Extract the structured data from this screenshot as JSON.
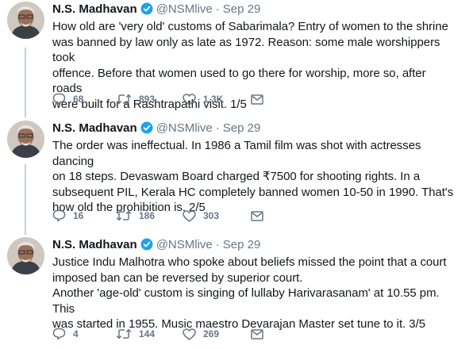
{
  "tweets": [
    {
      "name": "N.S. Madhavan",
      "handle": "@NSMlive",
      "separator": "·",
      "time": "Sep 29",
      "text": "How old are 'very old' customs of Sabarimala? Entry of women to the shrine\nwas banned by law only as late as 1972. Reason: some male worshippers took\noffence. Before that women used to go there for worship, more so, after roads\nwere built for a Rashtrapathi visit. 1/5",
      "replies": "68",
      "retweets": "893",
      "likes": "1.3K"
    },
    {
      "name": "N.S. Madhavan",
      "handle": "@NSMlive",
      "separator": "·",
      "time": "Sep 29",
      "text": "The order was ineffectual. In 1986 a Tamil film was shot with actresses dancing\non 18 steps. Devaswam Board charged ₹7500 for shooting rights. In a\nsubsequent PIL, Kerala HC completely banned women 10-50 in 1990. That's\nhow old the prohibition is. 2/5",
      "replies": "16",
      "retweets": "186",
      "likes": "303"
    },
    {
      "name": "N.S. Madhavan",
      "handle": "@NSMlive",
      "separator": "·",
      "time": "Sep 29",
      "text": "Justice Indu Malhotra who spoke about beliefs missed the point that a court\nimposed ban can be reversed by superior court.\nAnother 'age-old' custom is singing of lullaby Harivarasanam' at 10.55 pm. This\nwas started in 1955. Music maestro Devarajan Master set tune to it. 3/5",
      "replies": "4",
      "retweets": "144",
      "likes": "269"
    }
  ],
  "colors": {
    "text": "#14171a",
    "muted": "#657786",
    "verified": "#1da1f2",
    "thread_line": "#c4cfd6"
  },
  "icons": {
    "verified": "verified-badge-icon",
    "reply": "reply-icon",
    "retweet": "retweet-icon",
    "like": "like-icon",
    "message": "message-icon"
  }
}
